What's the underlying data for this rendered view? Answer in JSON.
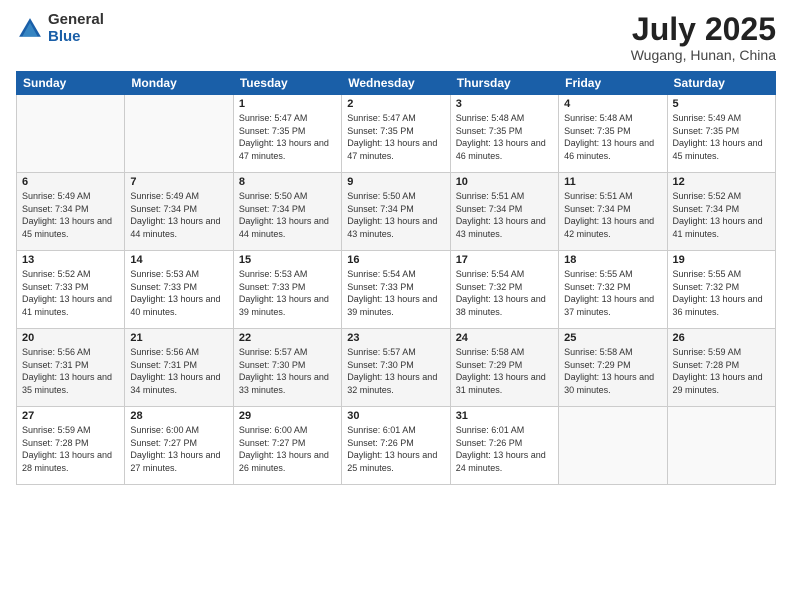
{
  "header": {
    "logo_general": "General",
    "logo_blue": "Blue",
    "month_title": "July 2025",
    "location": "Wugang, Hunan, China"
  },
  "days_of_week": [
    "Sunday",
    "Monday",
    "Tuesday",
    "Wednesday",
    "Thursday",
    "Friday",
    "Saturday"
  ],
  "weeks": [
    [
      {
        "day": "",
        "info": ""
      },
      {
        "day": "",
        "info": ""
      },
      {
        "day": "1",
        "info": "Sunrise: 5:47 AM\nSunset: 7:35 PM\nDaylight: 13 hours and 47 minutes."
      },
      {
        "day": "2",
        "info": "Sunrise: 5:47 AM\nSunset: 7:35 PM\nDaylight: 13 hours and 47 minutes."
      },
      {
        "day": "3",
        "info": "Sunrise: 5:48 AM\nSunset: 7:35 PM\nDaylight: 13 hours and 46 minutes."
      },
      {
        "day": "4",
        "info": "Sunrise: 5:48 AM\nSunset: 7:35 PM\nDaylight: 13 hours and 46 minutes."
      },
      {
        "day": "5",
        "info": "Sunrise: 5:49 AM\nSunset: 7:35 PM\nDaylight: 13 hours and 45 minutes."
      }
    ],
    [
      {
        "day": "6",
        "info": "Sunrise: 5:49 AM\nSunset: 7:34 PM\nDaylight: 13 hours and 45 minutes."
      },
      {
        "day": "7",
        "info": "Sunrise: 5:49 AM\nSunset: 7:34 PM\nDaylight: 13 hours and 44 minutes."
      },
      {
        "day": "8",
        "info": "Sunrise: 5:50 AM\nSunset: 7:34 PM\nDaylight: 13 hours and 44 minutes."
      },
      {
        "day": "9",
        "info": "Sunrise: 5:50 AM\nSunset: 7:34 PM\nDaylight: 13 hours and 43 minutes."
      },
      {
        "day": "10",
        "info": "Sunrise: 5:51 AM\nSunset: 7:34 PM\nDaylight: 13 hours and 43 minutes."
      },
      {
        "day": "11",
        "info": "Sunrise: 5:51 AM\nSunset: 7:34 PM\nDaylight: 13 hours and 42 minutes."
      },
      {
        "day": "12",
        "info": "Sunrise: 5:52 AM\nSunset: 7:34 PM\nDaylight: 13 hours and 41 minutes."
      }
    ],
    [
      {
        "day": "13",
        "info": "Sunrise: 5:52 AM\nSunset: 7:33 PM\nDaylight: 13 hours and 41 minutes."
      },
      {
        "day": "14",
        "info": "Sunrise: 5:53 AM\nSunset: 7:33 PM\nDaylight: 13 hours and 40 minutes."
      },
      {
        "day": "15",
        "info": "Sunrise: 5:53 AM\nSunset: 7:33 PM\nDaylight: 13 hours and 39 minutes."
      },
      {
        "day": "16",
        "info": "Sunrise: 5:54 AM\nSunset: 7:33 PM\nDaylight: 13 hours and 39 minutes."
      },
      {
        "day": "17",
        "info": "Sunrise: 5:54 AM\nSunset: 7:32 PM\nDaylight: 13 hours and 38 minutes."
      },
      {
        "day": "18",
        "info": "Sunrise: 5:55 AM\nSunset: 7:32 PM\nDaylight: 13 hours and 37 minutes."
      },
      {
        "day": "19",
        "info": "Sunrise: 5:55 AM\nSunset: 7:32 PM\nDaylight: 13 hours and 36 minutes."
      }
    ],
    [
      {
        "day": "20",
        "info": "Sunrise: 5:56 AM\nSunset: 7:31 PM\nDaylight: 13 hours and 35 minutes."
      },
      {
        "day": "21",
        "info": "Sunrise: 5:56 AM\nSunset: 7:31 PM\nDaylight: 13 hours and 34 minutes."
      },
      {
        "day": "22",
        "info": "Sunrise: 5:57 AM\nSunset: 7:30 PM\nDaylight: 13 hours and 33 minutes."
      },
      {
        "day": "23",
        "info": "Sunrise: 5:57 AM\nSunset: 7:30 PM\nDaylight: 13 hours and 32 minutes."
      },
      {
        "day": "24",
        "info": "Sunrise: 5:58 AM\nSunset: 7:29 PM\nDaylight: 13 hours and 31 minutes."
      },
      {
        "day": "25",
        "info": "Sunrise: 5:58 AM\nSunset: 7:29 PM\nDaylight: 13 hours and 30 minutes."
      },
      {
        "day": "26",
        "info": "Sunrise: 5:59 AM\nSunset: 7:28 PM\nDaylight: 13 hours and 29 minutes."
      }
    ],
    [
      {
        "day": "27",
        "info": "Sunrise: 5:59 AM\nSunset: 7:28 PM\nDaylight: 13 hours and 28 minutes."
      },
      {
        "day": "28",
        "info": "Sunrise: 6:00 AM\nSunset: 7:27 PM\nDaylight: 13 hours and 27 minutes."
      },
      {
        "day": "29",
        "info": "Sunrise: 6:00 AM\nSunset: 7:27 PM\nDaylight: 13 hours and 26 minutes."
      },
      {
        "day": "30",
        "info": "Sunrise: 6:01 AM\nSunset: 7:26 PM\nDaylight: 13 hours and 25 minutes."
      },
      {
        "day": "31",
        "info": "Sunrise: 6:01 AM\nSunset: 7:26 PM\nDaylight: 13 hours and 24 minutes."
      },
      {
        "day": "",
        "info": ""
      },
      {
        "day": "",
        "info": ""
      }
    ]
  ]
}
